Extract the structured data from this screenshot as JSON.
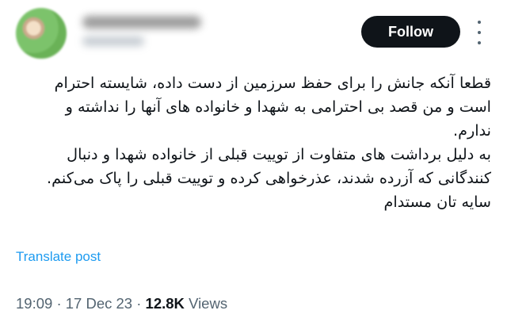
{
  "header": {
    "follow_label": "Follow",
    "more_icon": "more-vertical-icon"
  },
  "tweet": {
    "lines": [
      "قطعا آنکه جانش را برای حفظ سرزمین از دست داده، شایسته احترام",
      "است و من قصد بی احترامی به شهدا و خانواده های آنها را نداشته و",
      "ندارم.",
      "به دلیل برداشت های متفاوت از توییت قبلی از خانواده شهدا و دنبال",
      "کنندگانی که آزرده شدند، عذرخواهی کرده و توییت قبلی را پاک می‌کنم.",
      "سایه تان مستدام"
    ]
  },
  "translate_label": "Translate post",
  "meta": {
    "time": "19:09",
    "separator": "·",
    "date": "17 Dec 23",
    "views_count": "12.8K",
    "views_label": "Views"
  },
  "colors": {
    "follow_bg": "#0f1419",
    "link": "#1d9bf0",
    "secondary_text": "#536471"
  }
}
